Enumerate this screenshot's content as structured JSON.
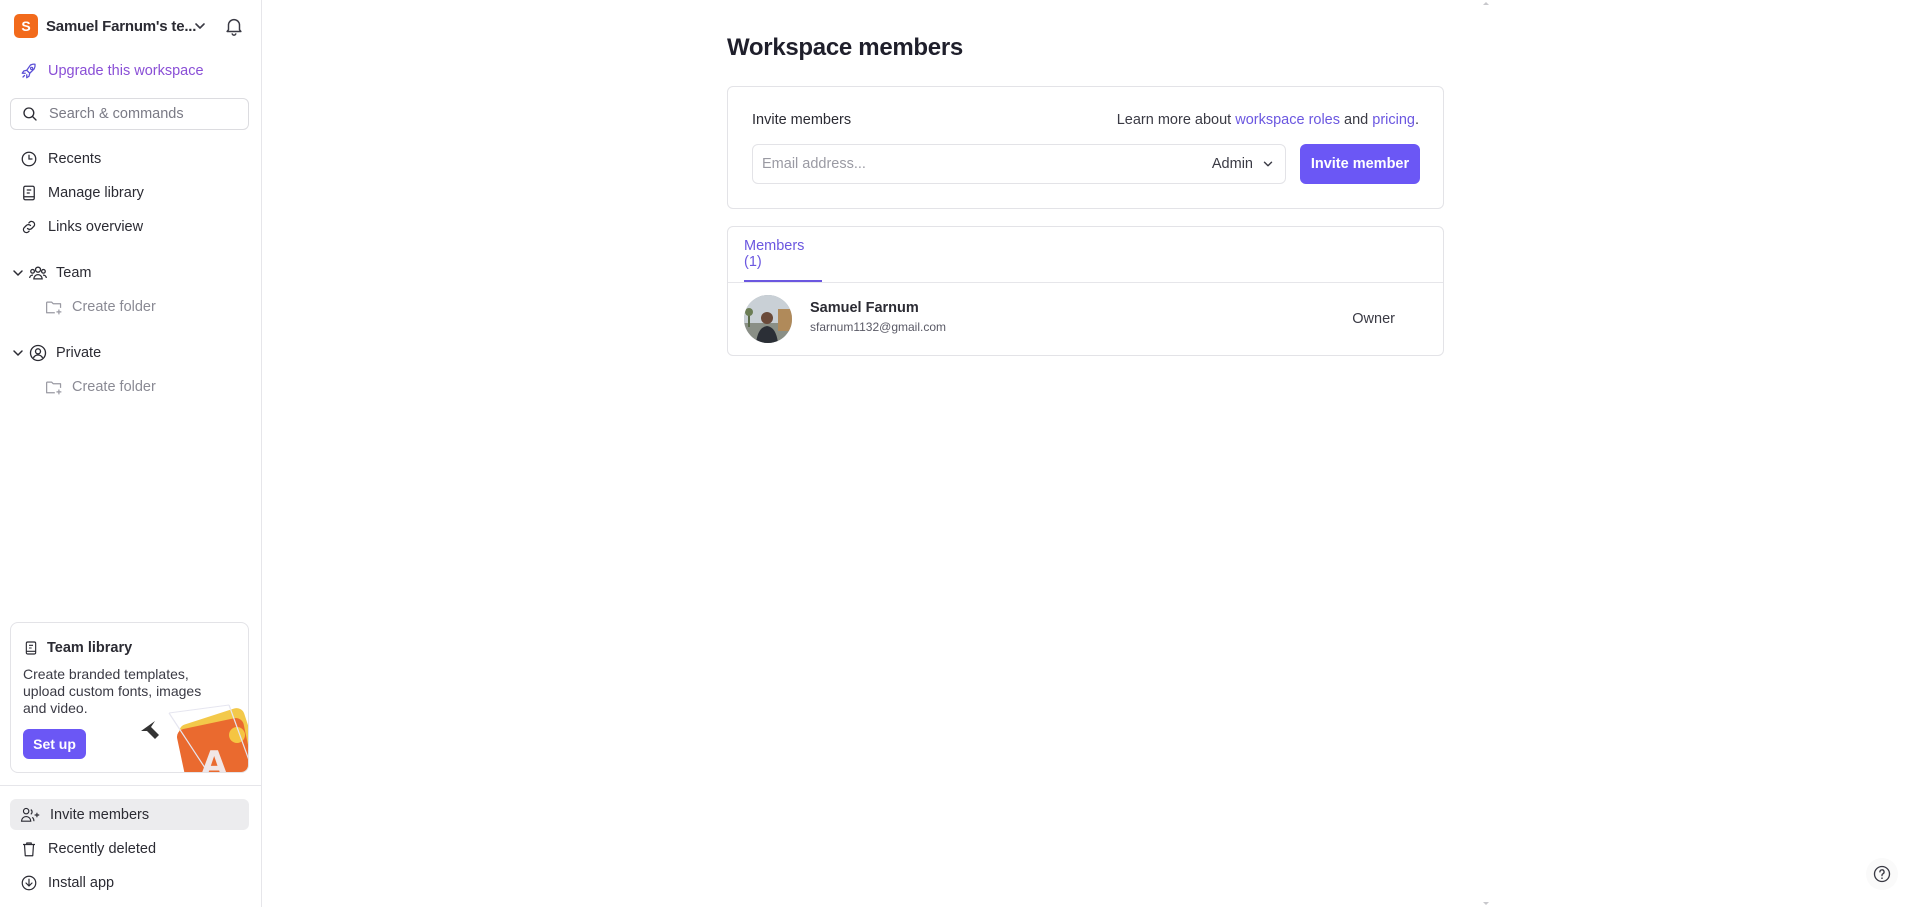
{
  "sidebar": {
    "workspace": {
      "initial": "S",
      "name": "Samuel Farnum's te...",
      "badge_color": "#f26a1b"
    },
    "upgrade_label": "Upgrade this workspace",
    "search_placeholder": "Search & commands",
    "nav": [
      {
        "label": "Recents",
        "icon": "clock-icon"
      },
      {
        "label": "Manage library",
        "icon": "book-icon"
      },
      {
        "label": "Links overview",
        "icon": "link-icon"
      }
    ],
    "groups": [
      {
        "label": "Team",
        "icon": "team-icon",
        "expanded": true,
        "children": [
          {
            "label": "Create folder",
            "icon": "folder-plus-icon"
          }
        ]
      },
      {
        "label": "Private",
        "icon": "user-circle-icon",
        "expanded": true,
        "children": [
          {
            "label": "Create folder",
            "icon": "folder-plus-icon"
          }
        ]
      }
    ],
    "promo": {
      "title": "Team library",
      "description": "Create branded templates, upload custom fonts, images and video.",
      "button": "Set up"
    },
    "bottom": [
      {
        "label": "Invite members",
        "icon": "user-plus-icon",
        "active": true
      },
      {
        "label": "Recently deleted",
        "icon": "trash-icon",
        "active": false
      },
      {
        "label": "Install app",
        "icon": "download-icon",
        "active": false
      }
    ]
  },
  "main": {
    "title": "Workspace members",
    "invite": {
      "label": "Invite members",
      "learn_prefix": "Learn more about ",
      "learn_link1": "workspace roles",
      "learn_mid": " and ",
      "learn_link2": "pricing",
      "learn_suffix": ".",
      "email_placeholder": "Email address...",
      "email_value": "",
      "role_selected": "Admin",
      "button": "Invite member"
    },
    "members": {
      "tab_label": "Members (1)",
      "list": [
        {
          "name": "Samuel Farnum",
          "email": "sfarnum1132@gmail.com",
          "role": "Owner"
        }
      ]
    }
  },
  "colors": {
    "accent": "#6b57f5",
    "link": "#6b57e0",
    "upgrade": "#8a4fd6"
  }
}
